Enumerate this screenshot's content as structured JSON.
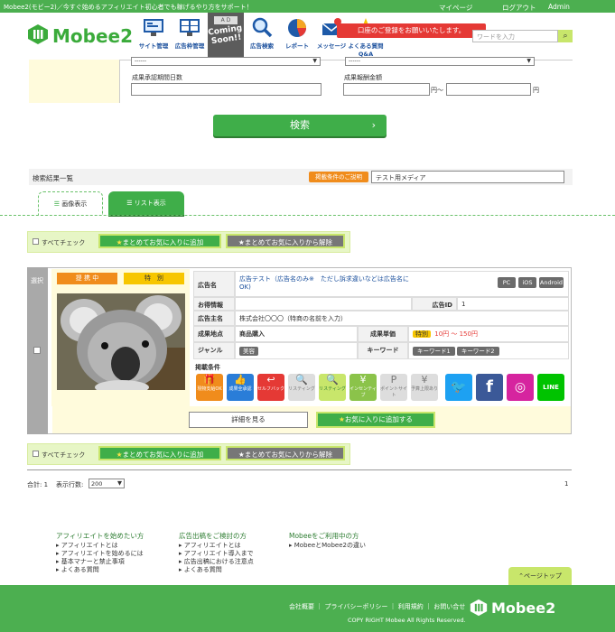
{
  "topbar": {
    "tagline": "Mobee2(モビー2)／今すぐ始めるアフィリエイト初心者でも稼げるやり方をサポート！",
    "mypage": "マイページ",
    "logout": "ログアウト",
    "admin": "Admin"
  },
  "header": {
    "logo": "Mobee",
    "logo_num": "2",
    "nav": [
      {
        "label": "サイト管理",
        "icon": "monitor-icon"
      },
      {
        "label": "広告枠管理",
        "icon": "ad-grid-icon"
      },
      {
        "label": "広告検索",
        "icon": "magnifier-icon"
      },
      {
        "label": "レポート",
        "icon": "pie-chart-icon"
      },
      {
        "label": "メッセージ",
        "icon": "envelope-icon"
      },
      {
        "label": "よくある質問",
        "icon": "star-icon"
      }
    ],
    "coming_soon": "Coming Soon!!",
    "ad_tag": "A D",
    "notice": "口座のご登録をお願いいたします。",
    "qa_label": "Q&A",
    "search_placeholder": "ワードを入力"
  },
  "form": {
    "select_left": "------",
    "select_right": "------",
    "approval_days_label": "成果承認期間日数",
    "reward_label": "成果報酬金額",
    "yen_from": "円〜",
    "yen_to": "円",
    "search_button": "検索"
  },
  "results": {
    "title": "検索結果一覧",
    "media_label": "掲載条件のご説明",
    "media_value": "テスト用メディア",
    "tab_image": "画像表示",
    "tab_list": "リスト表示",
    "check_all": "すべてチェック",
    "bulk_add": "まとめてお気に入りに追加",
    "bulk_remove": "まとめてお気に入りから解除"
  },
  "card": {
    "select_label": "選択",
    "status": "提 携 中",
    "special": "特　別",
    "ad_name_label": "広告名",
    "ad_name": "広告テスト（広告名のみ※　ただし訴求違いなどは広告名に",
    "ad_name2": "OK)",
    "platforms": [
      "PC",
      "iOS",
      "Android"
    ],
    "deal_label": "お得情報",
    "ad_id_label": "広告ID",
    "ad_id": "1",
    "owner_label": "広告主名",
    "owner": "株式会社〇〇〇（特商の名前を入力）",
    "point_label": "成果地点",
    "point": "商品購入",
    "price_label": "成果単価",
    "price_badge": "特別",
    "price": "10円 〜 150円",
    "genre_label": "ジャンル",
    "genre": "美容",
    "keyword_label": "キーワード",
    "keywords": [
      "キーワード1",
      "キーワード2"
    ],
    "conditions_label": "掲載条件",
    "conditions": [
      "現物支給OK",
      "成果全承認",
      "セルフバック",
      "リスティング",
      "リスティング",
      "インセンティブ",
      "ポイントサイト",
      "予算上限あり"
    ],
    "detail_button": "詳細を見る",
    "fav_button": "お気に入りに追加する"
  },
  "pager": {
    "total": "合計: 1",
    "rows_label": "表示行数:",
    "rows_value": "200",
    "page": "1"
  },
  "footer_links": {
    "col1_title": "アフィリエイトを始めたい方",
    "col1": [
      "アフィリエイトとは",
      "アフィリエイトを始めるには",
      "基本マナーと禁止事項",
      "よくある質問"
    ],
    "col2_title": "広告出稿をご検討の方",
    "col2": [
      "アフィリエイトとは",
      "アフィリエイト導入まで",
      "広告出稿における注意点",
      "よくある質問"
    ],
    "col3_title": "Mobeeをご利用中の方",
    "col3": [
      "MobeeとMobee2の違い"
    ],
    "page_top": "ページトップ"
  },
  "footer": {
    "links": [
      "会社概要",
      "プライバシーポリシー",
      "利用規約",
      "お問い合せ"
    ],
    "copyright": "COPY RIGHT Mobee All Rights Reserved.",
    "logo": "Mobee",
    "logo_num": "2"
  },
  "colors": {
    "brand": "#4caf50",
    "accent": "#3fae49",
    "notice": "#e53935",
    "highlight": "#fffbdc"
  }
}
